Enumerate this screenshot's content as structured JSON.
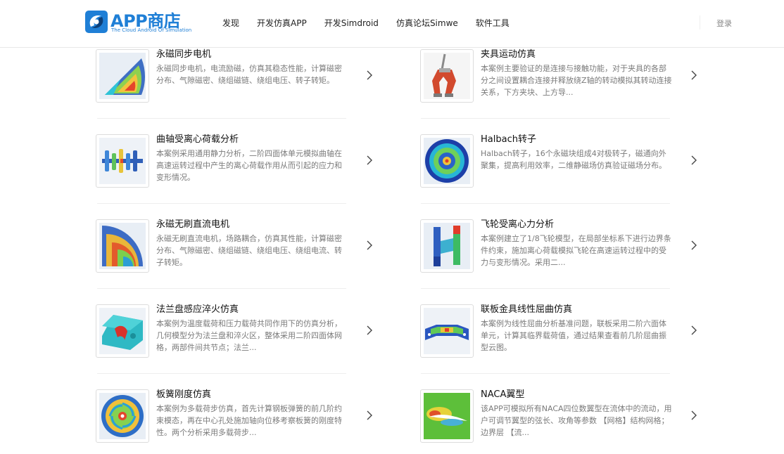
{
  "header": {
    "logo_title": "APP商店",
    "logo_subtitle": "The Cloud Android Of Simulation",
    "nav": [
      "发现",
      "开发仿真APP",
      "开发Simdroid",
      "仿真论坛Simwe",
      "软件工具"
    ],
    "login": "登录"
  },
  "left_cards": [
    {
      "title": "永磁同步电机",
      "desc": "永磁同步电机，电流励磁，仿真其稳态性能，计算磁密分布、气隙磁密、绕组磁链、绕组电压、转子转矩。",
      "icon": "motor-sector-thumbnail"
    },
    {
      "title": "曲轴受离心荷载分析",
      "desc": "本案例采用通用静力分析，二阶四面体单元模拟曲轴在高速运转过程中产生的离心荷载作用从而引起的应力和变形情况。",
      "icon": "crankshaft-thumbnail"
    },
    {
      "title": "永磁无刷直流电机",
      "desc": "永磁无刷直流电机，场路耦合，仿真其性能，计算磁密分布、气隙磁密、绕组磁链、绕组电压、绕组电流、转子转矩。",
      "icon": "bldc-motor-thumbnail"
    },
    {
      "title": "法兰盘感应淬火仿真",
      "desc": "本案例为温度载荷和压力载荷共同作用下的仿真分析，几何模型分为法兰盘和淬火区，整体采用二阶四面体网格，两部件间共节点；法兰...",
      "icon": "flange-thumbnail"
    },
    {
      "title": "板簧刚度仿真",
      "desc": "本案例为多载荷步仿真，首先计算钢板弹簧的前几阶约束模态，再在中心孔处施加轴向位移考察板簧的刚度特性。两个分析采用多载荷步...",
      "icon": "leaf-spring-thumbnail"
    }
  ],
  "right_cards": [
    {
      "title": "夹具运动仿真",
      "desc": "本案例主要验证的是连接与接触功能，对于夹具的各部分之间设置耦合连接并释放绕Z轴的转动模拟其转动连接关系，下方夹块、上方导...",
      "icon": "clamp-thumbnail"
    },
    {
      "title": "Halbach转子",
      "desc": "Halbach转子，16个永磁块组成4对极转子，磁通向外聚集，提高利用效率，二维静磁场仿真验证磁场分布。",
      "icon": "halbach-rotor-thumbnail"
    },
    {
      "title": "飞轮受离心力分析",
      "desc": "本案例建立了1/8飞轮模型，在局部坐标系下进行边界条件约束，施加离心荷载模拟飞轮在高速运转过程中的受力与变形情况。采用二...",
      "icon": "flywheel-thumbnail"
    },
    {
      "title": "联板金具线性屈曲仿真",
      "desc": "本案例为线性屈曲分析基准问题，联板采用二阶六面体单元，计算其临界载荷值，通过结果查看前几阶屈曲振型云图。",
      "icon": "yoke-plate-thumbnail"
    },
    {
      "title": "NACA翼型",
      "desc": "该APP可模拟所有NACA四位数翼型在流体中的流动，用户可调节翼型的弦长、攻角等参数 【网格】结构网格；边界层 【流...",
      "icon": "naca-airfoil-thumbnail"
    }
  ],
  "icons": {
    "chevron": "chevron-right-icon"
  },
  "colors": {
    "brand": "#1f7fd6",
    "title": "#111111",
    "desc": "#7a7a7a",
    "divider": "#eeeeee"
  }
}
